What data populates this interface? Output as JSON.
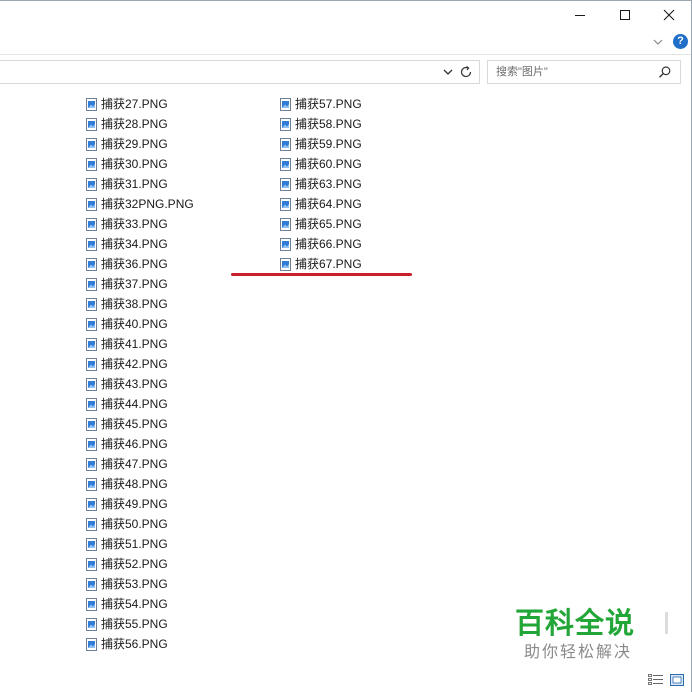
{
  "window": {
    "controls": {
      "minimize": "minimize",
      "maximize": "maximize",
      "close": "close"
    }
  },
  "ribbon": {
    "expand_icon": "chevron-down-icon",
    "help_label": "?"
  },
  "address_bar": {
    "dropdown_icon": "chevron-down-icon",
    "refresh_icon": "refresh-icon"
  },
  "search": {
    "placeholder": "搜索\"图片\"",
    "icon": "search-icon"
  },
  "files": {
    "column_1": [
      "捕获27.PNG",
      "捕获28.PNG",
      "捕获29.PNG",
      "捕获30.PNG",
      "捕获31.PNG",
      "捕获32PNG.PNG",
      "捕获33.PNG",
      "捕获34.PNG",
      "捕获36.PNG",
      "捕获37.PNG",
      "捕获38.PNG",
      "捕获40.PNG",
      "捕获41.PNG",
      "捕获42.PNG",
      "捕获43.PNG",
      "捕获44.PNG",
      "捕获45.PNG",
      "捕获46.PNG",
      "捕获47.PNG",
      "捕获48.PNG",
      "捕获49.PNG",
      "捕获50.PNG",
      "捕获51.PNG",
      "捕获52.PNG",
      "捕获53.PNG",
      "捕获54.PNG",
      "捕获55.PNG",
      "捕获56.PNG"
    ],
    "column_2": [
      "捕获57.PNG",
      "捕获58.PNG",
      "捕获59.PNG",
      "捕获60.PNG",
      "捕获63.PNG",
      "捕获64.PNG",
      "捕获65.PNG",
      "捕获66.PNG",
      "捕获67.PNG"
    ],
    "icon": "png-image-file-icon"
  },
  "annotation": {
    "color": "#c8202a"
  },
  "watermark": {
    "title": "百科全说",
    "subtitle": "助你轻松解决",
    "title_color": "#22a637"
  },
  "status_bar": {
    "details_view_icon": "details-view-icon",
    "large_icons_view_icon": "large-icons-view-icon"
  }
}
